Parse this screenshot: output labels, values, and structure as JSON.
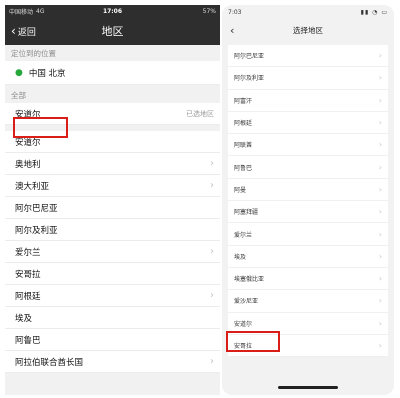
{
  "left": {
    "status": {
      "carrier": "中国移动",
      "network": "4G",
      "time": "17:06",
      "battery": "57%"
    },
    "nav": {
      "back_label": "返回",
      "title": "地区"
    },
    "located_header": "定位到的位置",
    "located_value": "中国 北京",
    "all_header": "全部",
    "selected": {
      "label": "安道尔",
      "note": "已选地区"
    },
    "regions": [
      {
        "label": "安道尔",
        "arrow": false
      },
      {
        "label": "奥地利",
        "arrow": true
      },
      {
        "label": "澳大利亚",
        "arrow": true
      },
      {
        "label": "阿尔巴尼亚",
        "arrow": false
      },
      {
        "label": "阿尔及利亚",
        "arrow": false
      },
      {
        "label": "爱尔兰",
        "arrow": true
      },
      {
        "label": "安哥拉",
        "arrow": false
      },
      {
        "label": "阿根廷",
        "arrow": true
      },
      {
        "label": "埃及",
        "arrow": false
      },
      {
        "label": "阿鲁巴",
        "arrow": false
      },
      {
        "label": "阿拉伯联合酋长国",
        "arrow": true
      }
    ],
    "accent": "#27a83c"
  },
  "right": {
    "status": {
      "time": "7:03"
    },
    "nav": {
      "title": "选择地区"
    },
    "regions": [
      "阿尔巴尼亚",
      "阿尔及利亚",
      "阿富汗",
      "阿根廷",
      "阿联酋",
      "阿鲁巴",
      "阿曼",
      "阿塞拜疆",
      "爱尔兰",
      "埃及",
      "埃塞俄比亚",
      "爱沙尼亚",
      "安道尔",
      "安哥拉"
    ]
  },
  "highlight_color": "#d91e18"
}
